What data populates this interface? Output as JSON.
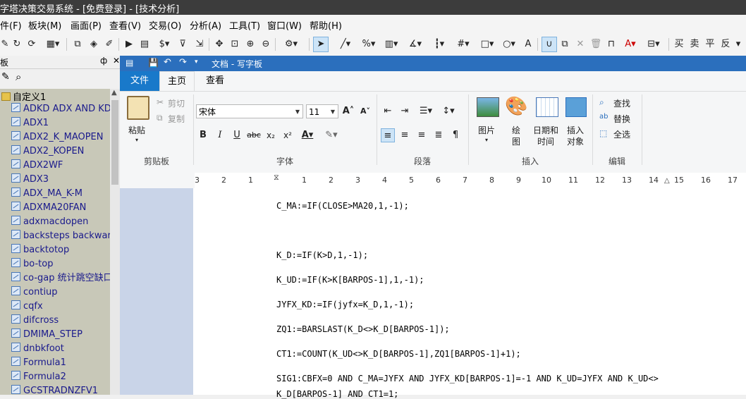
{
  "main_window": {
    "title": "字塔决策交易系统 - [免费登录] - [技术分析]"
  },
  "menubar": {
    "items": [
      "件(F)",
      "板块(M)",
      "画面(P)",
      "查看(V)",
      "交易(O)",
      "分析(A)",
      "工具(T)",
      "窗口(W)",
      "帮助(H)"
    ]
  },
  "toolbar": {
    "tools": [
      "line-tool",
      "percent-tool",
      "bar-tool",
      "angle-tool",
      "parallel-tool",
      "grid-tool",
      "rect-tool",
      "circle-tool",
      "text-tool"
    ],
    "right_labels": [
      "买",
      "卖",
      "平",
      "反"
    ],
    "font_letter": "A"
  },
  "left_panel": {
    "header_label": "板",
    "pin_glyph": "ф",
    "root_label": "自定义1",
    "items": [
      "ADKD ADX AND KD",
      "ADX1",
      "ADX2_K_MAOPEN",
      "ADX2_KOPEN",
      "ADX2WF",
      "ADX3",
      "ADX_MA_K-M",
      "ADXMA20FAN",
      "adxmacdopen",
      "backsteps backward",
      "backtotop",
      "bo-top",
      "co-gap 统计跳空缺口",
      "contiup",
      "cqfx",
      "difcross",
      "DMIMA_STEP",
      "dnbkfoot",
      "Formula1",
      "Formula2",
      "GCSTRADNZFV1"
    ]
  },
  "wordpad": {
    "title": "文档 - 写字板",
    "tabs": {
      "file": "文件",
      "home": "主页",
      "view": "查看"
    },
    "clipboard": {
      "paste": "粘贴",
      "cut": "剪切",
      "copy": "复制",
      "label": "剪贴板"
    },
    "font": {
      "family": "宋体",
      "size": "11",
      "label": "字体"
    },
    "paragraph": {
      "label": "段落"
    },
    "insert": {
      "picture": "图片",
      "paint1": "绘",
      "paint2": "图",
      "datetime1": "日期和",
      "datetime2": "时间",
      "object1": "插入",
      "object2": "对象",
      "label": "插入"
    },
    "editing": {
      "find": "查找",
      "replace": "替换",
      "select_all": "全选",
      "label": "编辑"
    },
    "ruler": {
      "numbers": [
        "3",
        "2",
        "1",
        "1",
        "2",
        "3",
        "4",
        "5",
        "6",
        "7",
        "8",
        "9",
        "10",
        "11",
        "12",
        "13",
        "14",
        "15",
        "16",
        "17"
      ]
    },
    "document_lines": [
      "C_MA:=IF(CLOSE>MA20,1,-1);",
      "K_D:=IF(K>D,1,-1);",
      "K_UD:=IF(K>K[BARPOS-1],1,-1);",
      "JYFX_KD:=IF(jyfx=K_D,1,-1);",
      "ZQ1:=BARSLAST(K_D<>K_D[BARPOS-1]);",
      "CT1:=COUNT(K_UD<>K_D[BARPOS-1],ZQ1[BARPOS-1]+1);",
      "SIG1:CBFX=0 AND C_MA=JYFX AND JYFX_KD[BARPOS-1]=-1 AND K_UD=JYFX AND K_UD<>",
      "K_D[BARPOS-1] AND CT1=1;"
    ]
  },
  "colors": {
    "titlebar": "#3c3c3c",
    "wordpad_title": "#2b6fbd",
    "file_tab": "#1979ca",
    "tree_bg": "#c8c8b8",
    "tree_text": "#1a1a8c"
  }
}
